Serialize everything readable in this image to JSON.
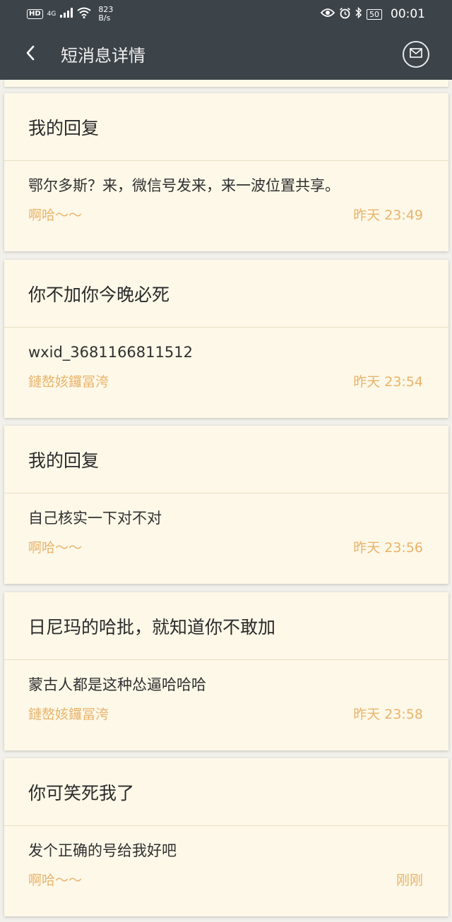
{
  "status_bar": {
    "hd": "HD",
    "network": "4G",
    "speed_value": "823",
    "speed_unit": "B/s",
    "battery": "50",
    "time": "00:01"
  },
  "header": {
    "title": "短消息详情"
  },
  "messages": [
    {
      "title": "我的回复",
      "body": "鄂尔多斯？来，微信号发来，来一波位置共享。",
      "sender": "啊哈～～",
      "time": "昨天  23:49"
    },
    {
      "title": "你不加你今晚必死",
      "body": "wxid_3681166811512",
      "sender": "鏈嶅姟鑼冨洿",
      "time": "昨天  23:54"
    },
    {
      "title": "我的回复",
      "body": "自己核实一下对不对",
      "sender": "啊哈～～",
      "time": "昨天  23:56"
    },
    {
      "title": "日尼玛的哈批，就知道你不敢加",
      "body": "蒙古人都是这种怂逼哈哈哈",
      "sender": "鏈嶅姟鑼冨洿",
      "time": "昨天  23:58"
    },
    {
      "title": "你可笑死我了",
      "body": "发个正确的号给我好吧",
      "sender": "啊哈～～",
      "time": "刚刚"
    }
  ],
  "colors": {
    "bar": "#3c4349",
    "card": "#fdf8e8",
    "meta": "#e9b36b"
  }
}
